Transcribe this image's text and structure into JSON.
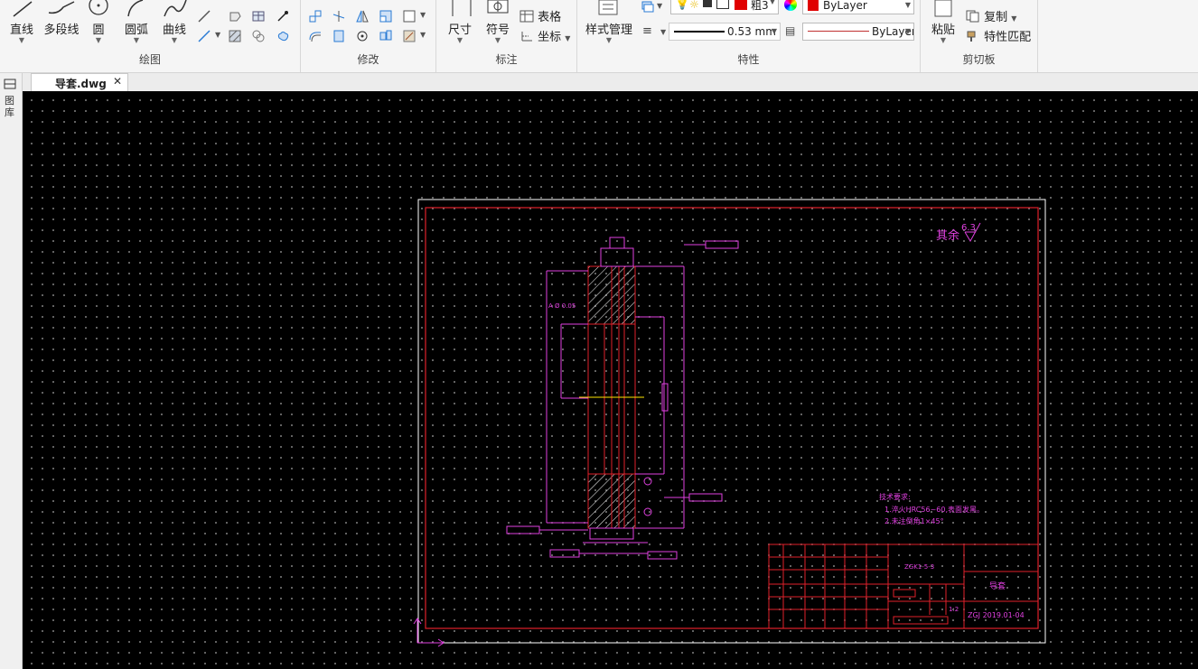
{
  "ribbon": {
    "draw": {
      "title": "绘图",
      "line": "直线",
      "polyline": "多段线",
      "circle": "圆",
      "arc": "圆弧",
      "curve": "曲线"
    },
    "modify": {
      "title": "修改"
    },
    "annotate": {
      "title": "标注",
      "dimension": "尺寸",
      "symbol": "符号",
      "table": "表格",
      "coordinate": "坐标"
    },
    "properties": {
      "title": "特性",
      "style_manager": "样式管理",
      "layer_value": "粗3",
      "color_value": "ByLayer",
      "lineweight_value": "0.53 mm",
      "linetype_value": "ByLayer"
    },
    "clipboard": {
      "title": "剪切板",
      "paste": "粘贴",
      "copy": "复制",
      "match_props": "特性匹配"
    }
  },
  "tabs": [
    {
      "label": "导套.dwg",
      "active": true
    }
  ],
  "side_panel": {
    "label": "图库"
  },
  "drawing": {
    "surface_finish_note": "其余",
    "roughness_value": "6.3",
    "datum_note": "A Ø 0.05",
    "tech_req_title": "技术要求:",
    "tech_req_line1": "1.淬火HRC56~60,表面发黑。",
    "tech_req_line2": "2.未注倒角1×45°",
    "title_block": {
      "drawing_no": "ZGK1-5-3",
      "part_name": "导套",
      "scale": "1:2",
      "company_date": "ZGJ 2019.01-04"
    }
  },
  "colors": {
    "border_red": "#e0202a",
    "dimension_magenta": "#e040e0",
    "frame_white": "#ffffff",
    "hatch_white": "#ffffff",
    "center_yellow": "#ffe600",
    "accent_red_swatch": "#e00000"
  }
}
